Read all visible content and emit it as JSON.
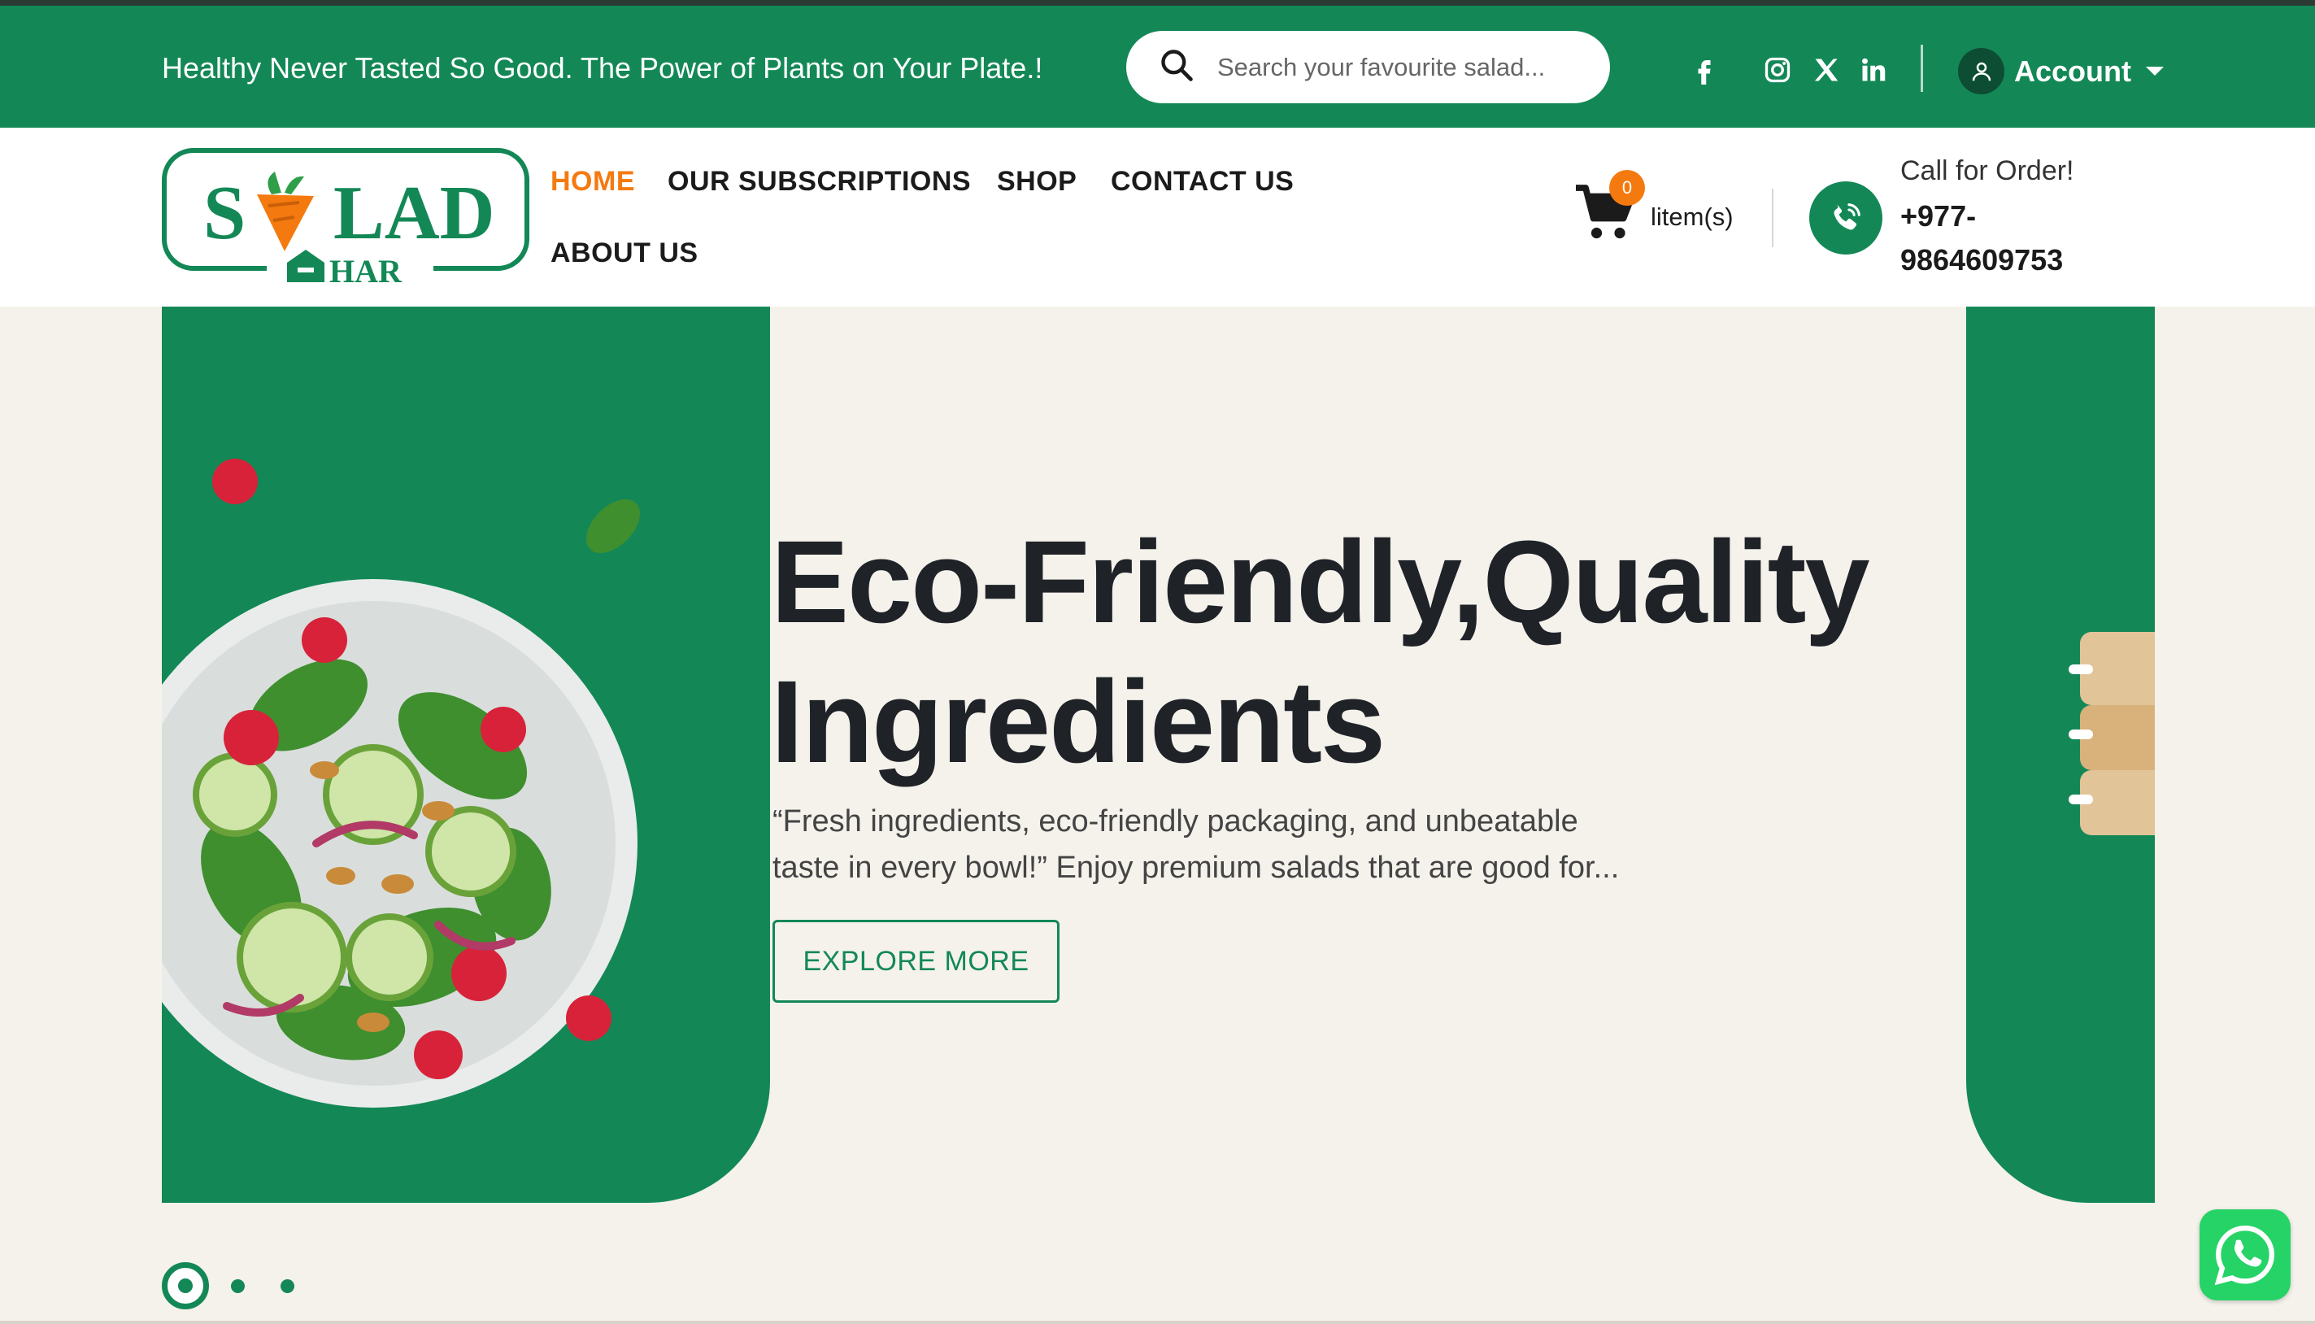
{
  "topbar": {
    "tagline": "Healthy Never Tasted So Good. The Power of Plants on Your Plate.!",
    "search_placeholder": "Search your favourite salad...",
    "social_icons": [
      "facebook-icon",
      "instagram-icon",
      "x-icon",
      "linkedin-icon"
    ],
    "account_label": "Account"
  },
  "logo": {
    "line1": "S",
    "line1_rest": "LAD",
    "line2": "HAR"
  },
  "nav": {
    "items": [
      {
        "label": "HOME",
        "active": true
      },
      {
        "label": "OUR SUBSCRIPTIONS",
        "active": false
      },
      {
        "label": "SHOP",
        "active": false
      },
      {
        "label": "CONTACT US",
        "active": false
      },
      {
        "label": "ABOUT US",
        "active": false
      }
    ]
  },
  "cart": {
    "count": "0",
    "label": "litem(s)"
  },
  "contact": {
    "title": "Call for Order!",
    "phone_line1": "+977-",
    "phone_line2": "9864609753"
  },
  "hero": {
    "title_line1": "Eco-Friendly,Quality",
    "title_line2": "Ingredients",
    "subtitle_line1": "“Fresh ingredients, eco-friendly packaging, and unbeatable",
    "subtitle_line2": "taste in every bowl!” Enjoy premium salads that are good for...",
    "button_label": "EXPLORE MORE"
  },
  "slider": {
    "total": 3,
    "active": 1
  },
  "colors": {
    "brand_green": "#138856",
    "accent_orange": "#f47a10",
    "dark_text": "#1f2328",
    "page_bg": "#f5f2ec",
    "whatsapp_green": "#25d366"
  }
}
